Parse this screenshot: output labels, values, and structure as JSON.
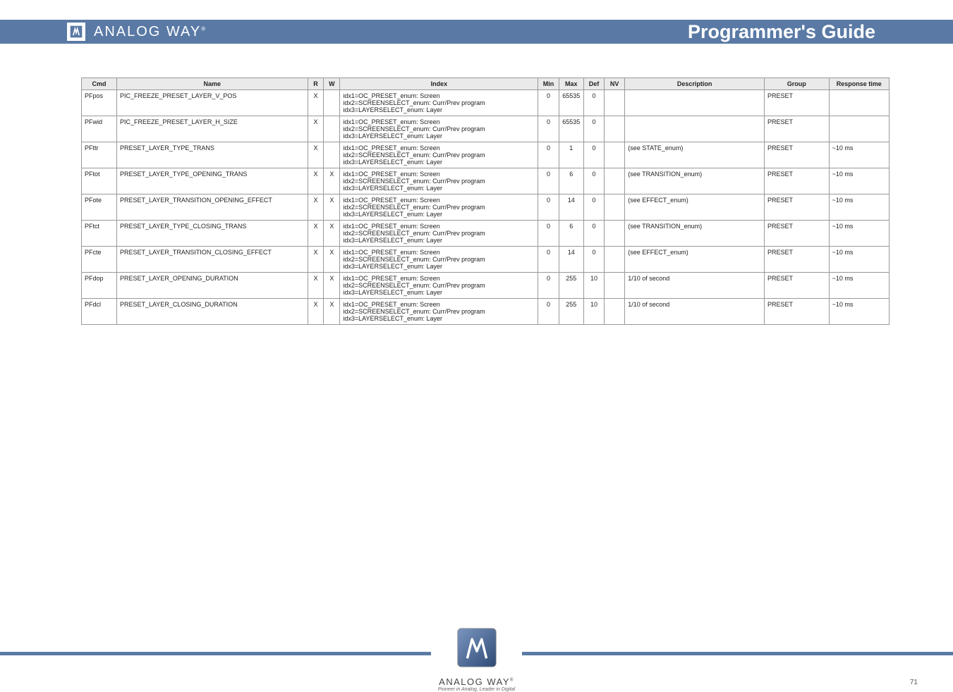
{
  "header": {
    "brand": "ANALOG WAY",
    "reg": "®",
    "title": "Programmer's Guide"
  },
  "table": {
    "headers": [
      "Cmd",
      "Name",
      "R",
      "W",
      "Index",
      "Min",
      "Max",
      "Def",
      "NV",
      "Description",
      "Group",
      "Response time"
    ],
    "rows": [
      {
        "cmd": "PFpos",
        "name": "PIC_FREEZE_PRESET_LAYER_V_POS",
        "r": "X",
        "w": "",
        "idx": "idx1=OC_PRESET_enum: Screen\nidx2=SCREENSELECT_enum: Curr/Prev program\nidx3=LAYERSELECT_enum: Layer",
        "min": "0",
        "max": "65535",
        "def": "0",
        "nv": "",
        "desc": "",
        "grp": "PRESET",
        "resp": ""
      },
      {
        "cmd": "PFwid",
        "name": "PIC_FREEZE_PRESET_LAYER_H_SIZE",
        "r": "X",
        "w": "",
        "idx": "idx1=OC_PRESET_enum: Screen\nidx2=SCREENSELECT_enum: Curr/Prev program\nidx3=LAYERSELECT_enum: Layer",
        "min": "0",
        "max": "65535",
        "def": "0",
        "nv": "",
        "desc": "",
        "grp": "PRESET",
        "resp": ""
      },
      {
        "cmd": "PFttr",
        "name": "PRESET_LAYER_TYPE_TRANS",
        "r": "X",
        "w": "",
        "idx": "idx1=OC_PRESET_enum: Screen\nidx2=SCREENSELECT_enum: Curr/Prev program\nidx3=LAYERSELECT_enum: Layer",
        "min": "0",
        "max": "1",
        "def": "0",
        "nv": "",
        "desc": "(see STATE_enum)",
        "grp": "PRESET",
        "resp": "~10 ms"
      },
      {
        "cmd": "PFtot",
        "name": "PRESET_LAYER_TYPE_OPENING_TRANS",
        "r": "X",
        "w": "X",
        "idx": "idx1=OC_PRESET_enum: Screen\nidx2=SCREENSELECT_enum: Curr/Prev program\nidx3=LAYERSELECT_enum: Layer",
        "min": "0",
        "max": "6",
        "def": "0",
        "nv": "",
        "desc": "(see TRANSITION_enum)",
        "grp": "PRESET",
        "resp": "~10 ms"
      },
      {
        "cmd": "PFote",
        "name": "PRESET_LAYER_TRANSITION_OPENING_EFFECT",
        "r": "X",
        "w": "X",
        "idx": "idx1=OC_PRESET_enum: Screen\nidx2=SCREENSELECT_enum: Curr/Prev program\nidx3=LAYERSELECT_enum: Layer",
        "min": "0",
        "max": "14",
        "def": "0",
        "nv": "",
        "desc": "(see EFFECT_enum)",
        "grp": "PRESET",
        "resp": "~10 ms"
      },
      {
        "cmd": "PFtct",
        "name": "PRESET_LAYER_TYPE_CLOSING_TRANS",
        "r": "X",
        "w": "X",
        "idx": "idx1=OC_PRESET_enum: Screen\nidx2=SCREENSELECT_enum: Curr/Prev program\nidx3=LAYERSELECT_enum: Layer",
        "min": "0",
        "max": "6",
        "def": "0",
        "nv": "",
        "desc": "(see TRANSITION_enum)",
        "grp": "PRESET",
        "resp": "~10 ms"
      },
      {
        "cmd": "PFcte",
        "name": "PRESET_LAYER_TRANSITION_CLOSING_EFFECT",
        "r": "X",
        "w": "X",
        "idx": "idx1=OC_PRESET_enum: Screen\nidx2=SCREENSELECT_enum: Curr/Prev program\nidx3=LAYERSELECT_enum: Layer",
        "min": "0",
        "max": "14",
        "def": "0",
        "nv": "",
        "desc": "(see EFFECT_enum)",
        "grp": "PRESET",
        "resp": "~10 ms"
      },
      {
        "cmd": "PFdop",
        "name": "PRESET_LAYER_OPENING_DURATION",
        "r": "X",
        "w": "X",
        "idx": "idx1=OC_PRESET_enum: Screen\nidx2=SCREENSELECT_enum: Curr/Prev program\nidx3=LAYERSELECT_enum: Layer",
        "min": "0",
        "max": "255",
        "def": "10",
        "nv": "",
        "desc": "1/10 of second",
        "grp": "PRESET",
        "resp": "~10 ms"
      },
      {
        "cmd": "PFdcl",
        "name": "PRESET_LAYER_CLOSING_DURATION",
        "r": "X",
        "w": "X",
        "idx": "idx1=OC_PRESET_enum: Screen\nidx2=SCREENSELECT_enum: Curr/Prev program\nidx3=LAYERSELECT_enum: Layer",
        "min": "0",
        "max": "255",
        "def": "10",
        "nv": "",
        "desc": "1/10 of second",
        "grp": "PRESET",
        "resp": "~10 ms"
      }
    ]
  },
  "footer": {
    "brand": "ANALOG WAY",
    "reg": "®",
    "tag": "Pioneer in Analog, Leader in Digital"
  },
  "page": "71"
}
